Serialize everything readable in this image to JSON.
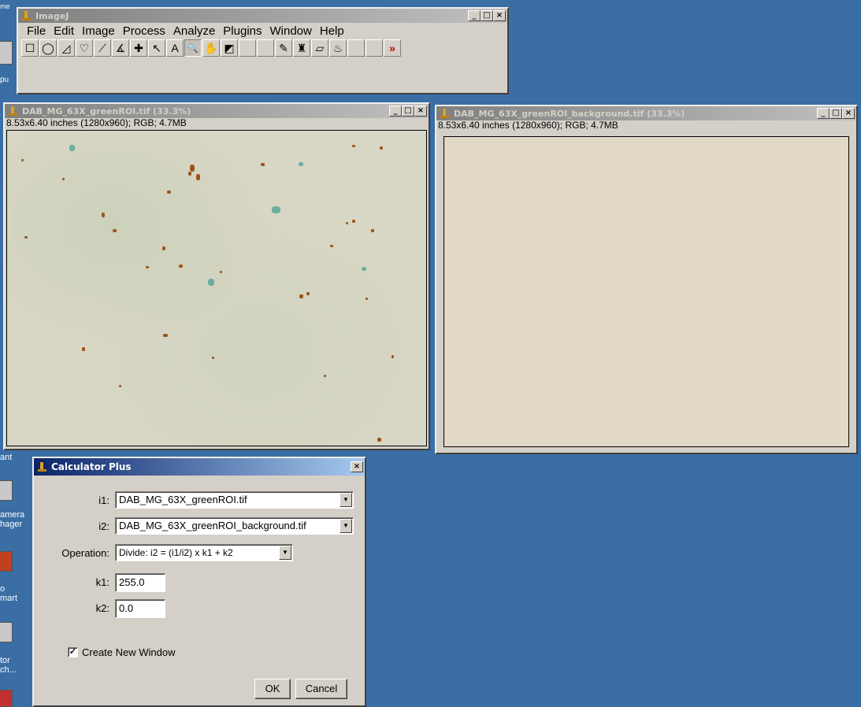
{
  "imagej": {
    "title": "ImageJ",
    "menus": [
      "File",
      "Edit",
      "Image",
      "Process",
      "Analyze",
      "Plugins",
      "Window",
      "Help"
    ],
    "tools": [
      {
        "name": "rectangle-tool",
        "glyph": "☐"
      },
      {
        "name": "oval-tool",
        "glyph": "◯"
      },
      {
        "name": "polygon-tool",
        "glyph": "◿"
      },
      {
        "name": "freehand-tool",
        "glyph": "♡"
      },
      {
        "name": "line-tool",
        "glyph": "⟋"
      },
      {
        "name": "angle-tool",
        "glyph": "∡"
      },
      {
        "name": "point-tool",
        "glyph": "✚"
      },
      {
        "name": "wand-tool",
        "glyph": "↖"
      },
      {
        "name": "text-tool",
        "glyph": "A"
      },
      {
        "name": "magnifier-tool",
        "glyph": "🔍"
      },
      {
        "name": "hand-tool",
        "glyph": "✋"
      },
      {
        "name": "color-picker-tool",
        "glyph": "◩"
      },
      {
        "name": "blank-tool-1",
        "glyph": ""
      },
      {
        "name": "blank-tool-2",
        "glyph": ""
      },
      {
        "name": "pencil-tool",
        "glyph": "✎"
      },
      {
        "name": "brush-tool",
        "glyph": "♜"
      },
      {
        "name": "eraser-tool",
        "glyph": "▱"
      },
      {
        "name": "flood-fill-tool",
        "glyph": "♨"
      },
      {
        "name": "blank-tool-3",
        "glyph": ""
      },
      {
        "name": "blank-tool-4",
        "glyph": ""
      },
      {
        "name": "more-tools",
        "glyph": "»"
      }
    ]
  },
  "window1": {
    "title": "DAB_MG_63X_greenROI.tif (33.3%)",
    "info": "8.53x6.40 inches (1280x960); RGB; 4.7MB"
  },
  "window2": {
    "title": "DAB_MG_63X_greenROI_background.tif (33.3%)",
    "info": "8.53x6.40 inches (1280x960); RGB; 4.7MB"
  },
  "calculator": {
    "title": "Calculator Plus",
    "i1_label": "i1:",
    "i1_value": "DAB_MG_63X_greenROI.tif",
    "i2_label": "i2:",
    "i2_value": "DAB_MG_63X_greenROI_background.tif",
    "operation_label": "Operation:",
    "operation_value": "Divide: i2 = (i1/i2) x k1 + k2",
    "k1_label": "k1:",
    "k1_value": "255.0",
    "k2_label": "k2:",
    "k2_value": "0.0",
    "create_new_window_label": "Create New Window",
    "create_new_window_checked": true,
    "ok_label": "OK",
    "cancel_label": "Cancel"
  },
  "window_controls": {
    "minimize": "_",
    "maximize": "□",
    "close": "×"
  },
  "colors": {
    "desktop": "#3a6ea5",
    "dab_brown": "#9a5418",
    "stain_teal": "#6aaea0"
  }
}
